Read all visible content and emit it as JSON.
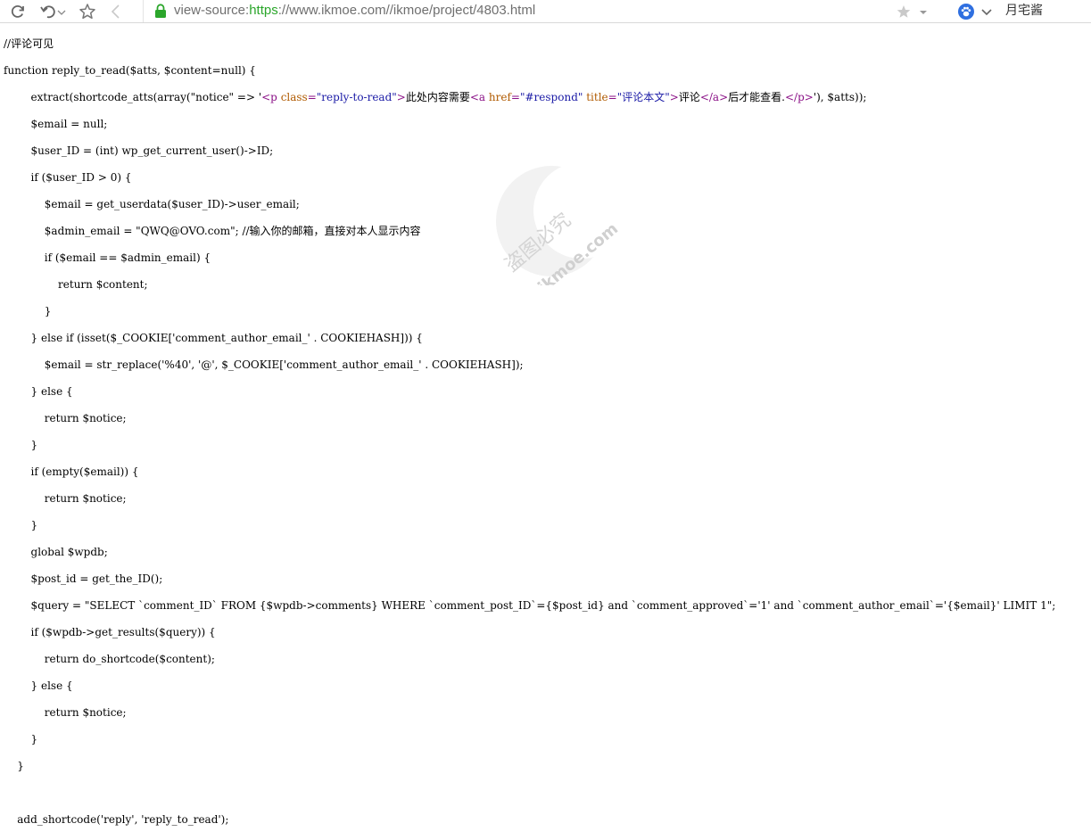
{
  "browser": {
    "url_prefix": "view-source:",
    "url_scheme": "https",
    "url_rest": "://www.ikmoe.com//ikmoe/project/4803.html",
    "user_name": "月宅酱"
  },
  "watermark": {
    "text_cn": "盗图必究",
    "text_en": "ikmoe.com"
  },
  "source": {
    "line_01": "//评论可见",
    "line_02": "function reply_to_read($atts, $content=null) {",
    "line_03": {
      "before": "        extract(shortcode_atts(array(\"notice\" => '",
      "tag_p_open": "<p ",
      "attr_class": "class",
      "eq1": "=",
      "val_class": "\"reply-to-read\"",
      "tag_p_close_bracket": ">",
      "text1": "此处内容需要",
      "tag_a_open": "<a ",
      "attr_href": "href",
      "eq2": "=",
      "val_href": "\"#respond\"",
      "space": " ",
      "attr_title": "title",
      "eq3": "=",
      "val_title": "\"评论本文\"",
      "tag_a_close_bracket": ">",
      "text2": "评论",
      "tag_a_end": "</a>",
      "text3": "后才能查看.",
      "tag_p_end": "</p>",
      "after": "'), $atts));"
    },
    "line_04": "        $email = null;",
    "line_05": "        $user_ID = (int) wp_get_current_user()->ID;",
    "line_06": "        if ($user_ID > 0) {",
    "line_07": "            $email = get_userdata($user_ID)->user_email;",
    "line_08": "            $admin_email = \"QWQ@OVO.com\"; //输入你的邮箱，直接对本人显示内容",
    "line_09": "            if ($email == $admin_email) {",
    "line_10": "                return $content;",
    "line_11": "            }",
    "line_12": "        } else if (isset($_COOKIE['comment_author_email_' . COOKIEHASH])) {",
    "line_13": "            $email = str_replace('%40', '@', $_COOKIE['comment_author_email_' . COOKIEHASH]);",
    "line_14": "        } else {",
    "line_15": "            return $notice;",
    "line_16": "        }",
    "line_17": "        if (empty($email)) {",
    "line_18": "            return $notice;",
    "line_19": "        }",
    "line_20": "        global $wpdb;",
    "line_21": "        $post_id = get_the_ID();",
    "line_22": "        $query = \"SELECT `comment_ID` FROM {$wpdb->comments} WHERE `comment_post_ID`={$post_id} and `comment_approved`='1' and `comment_author_email`='{$email}' LIMIT 1\";",
    "line_23": "        if ($wpdb->get_results($query)) {",
    "line_24": "            return do_shortcode($content);",
    "line_25": "        } else {",
    "line_26": "            return $notice;",
    "line_27": "        }",
    "line_28": "    }",
    "line_29": "",
    "line_30": "    add_shortcode('reply', 'reply_to_read');"
  }
}
